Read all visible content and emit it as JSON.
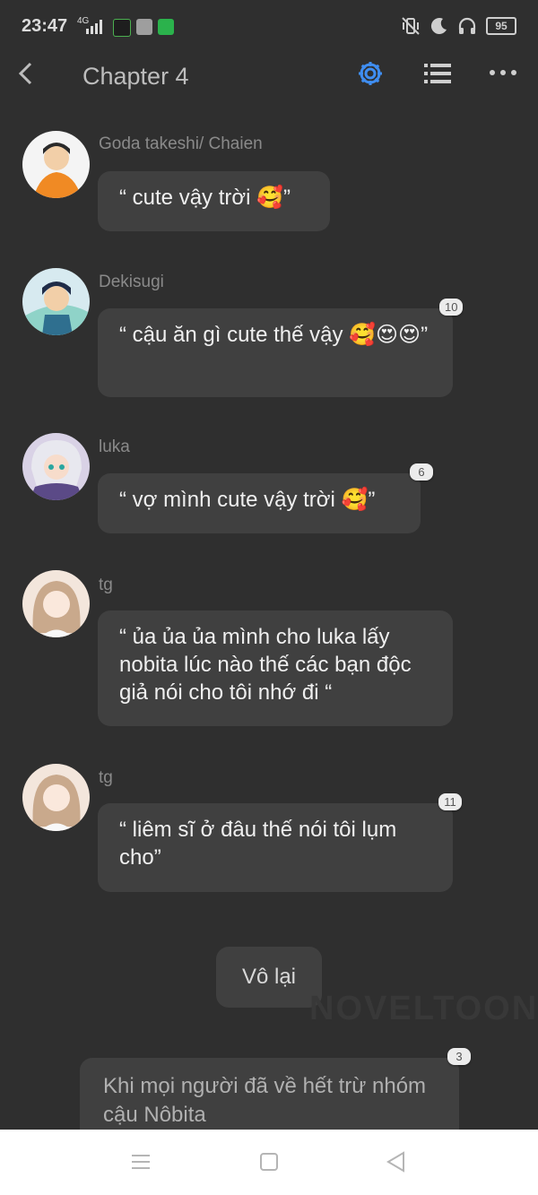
{
  "status_bar": {
    "time": "23:47",
    "network": "4G",
    "battery": "95"
  },
  "header": {
    "title": "Chapter 4",
    "settings_color": "#3f8ef2"
  },
  "messages": [
    {
      "name": "Goda  takeshi/ Chaien",
      "text": "“ cute vậy trời 🥰”",
      "badge": "",
      "avatar_colors": [
        "#f4f4f4",
        "#f08a24"
      ]
    },
    {
      "name": "Dekisugi",
      "text": "“ cậu ăn gì cute thế vậy 🥰😍😍”",
      "badge": "10",
      "avatar_colors": [
        "#d7eaf0",
        "#2f6f8f"
      ]
    },
    {
      "name": "luka",
      "text": "“ vợ mình cute vậy trời 🥰”",
      "badge": "6",
      "avatar_colors": [
        "#d9d2e6",
        "#5b4a87"
      ]
    },
    {
      "name": "tg",
      "text": "“ ủa ủa ủa mình cho luka lấy nobita lúc nào thế các bạn độc giả nói cho tôi nhớ đi “",
      "badge": "",
      "avatar_colors": [
        "#f3e6dc",
        "#c9a98c"
      ]
    },
    {
      "name": "tg",
      "text": "“ liêm sĩ ở đâu thế nói tôi lụm cho”",
      "badge": "11",
      "avatar_colors": [
        "#f3e6dc",
        "#c9a98c"
      ]
    }
  ],
  "center_message": "Vô lại",
  "watermark": "NOVELTOON",
  "narration": {
    "text": "Khi mọi người đã về hết trừ nhóm cậu Nôbita",
    "badge": "3"
  }
}
